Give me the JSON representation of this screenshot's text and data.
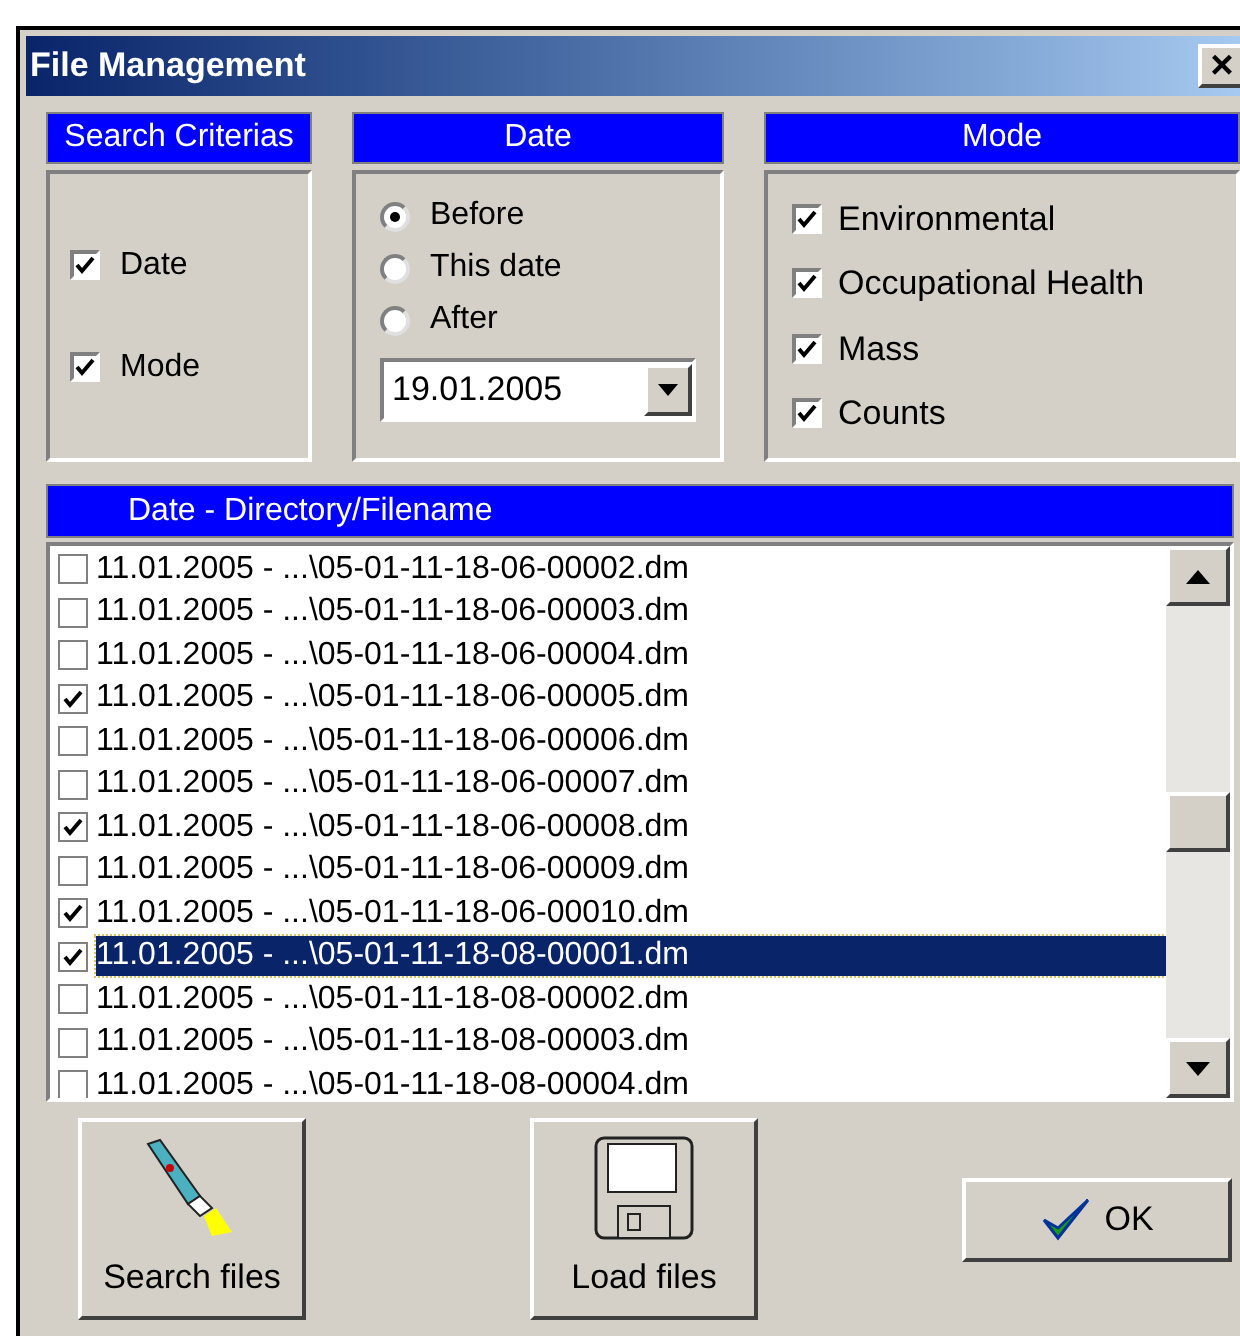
{
  "window": {
    "title": "File Management",
    "close": "×"
  },
  "search_criterias": {
    "title": "Search Criterias",
    "items": [
      {
        "label": "Date",
        "checked": true
      },
      {
        "label": "Mode",
        "checked": true
      }
    ]
  },
  "date": {
    "title": "Date",
    "options": [
      {
        "label": "Before",
        "selected": true
      },
      {
        "label": "This date",
        "selected": false
      },
      {
        "label": "After",
        "selected": false
      }
    ],
    "value": "19.01.2005"
  },
  "mode": {
    "title": "Mode",
    "items": [
      {
        "label": "Environmental",
        "checked": true
      },
      {
        "label": "Occupational Health",
        "checked": true
      },
      {
        "label": "Mass",
        "checked": true
      },
      {
        "label": "Counts",
        "checked": true
      }
    ]
  },
  "file_list": {
    "header": "Date - Directory/Filename",
    "rows": [
      {
        "text": "11.01.2005 - ...\\05-01-11-18-06-00002.dm",
        "checked": false,
        "selected": false
      },
      {
        "text": "11.01.2005 - ...\\05-01-11-18-06-00003.dm",
        "checked": false,
        "selected": false
      },
      {
        "text": "11.01.2005 - ...\\05-01-11-18-06-00004.dm",
        "checked": false,
        "selected": false
      },
      {
        "text": "11.01.2005 - ...\\05-01-11-18-06-00005.dm",
        "checked": true,
        "selected": false
      },
      {
        "text": "11.01.2005 - ...\\05-01-11-18-06-00006.dm",
        "checked": false,
        "selected": false
      },
      {
        "text": "11.01.2005 - ...\\05-01-11-18-06-00007.dm",
        "checked": false,
        "selected": false
      },
      {
        "text": "11.01.2005 - ...\\05-01-11-18-06-00008.dm",
        "checked": true,
        "selected": false
      },
      {
        "text": "11.01.2005 - ...\\05-01-11-18-06-00009.dm",
        "checked": false,
        "selected": false
      },
      {
        "text": "11.01.2005 - ...\\05-01-11-18-06-00010.dm",
        "checked": true,
        "selected": false
      },
      {
        "text": "11.01.2005 - ...\\05-01-11-18-08-00001.dm",
        "checked": true,
        "selected": true
      },
      {
        "text": "11.01.2005 - ...\\05-01-11-18-08-00002.dm",
        "checked": false,
        "selected": false
      },
      {
        "text": "11.01.2005 - ...\\05-01-11-18-08-00003.dm",
        "checked": false,
        "selected": false
      },
      {
        "text": "11.01.2005 - ...\\05-01-11-18-08-00004.dm",
        "checked": false,
        "selected": false
      }
    ]
  },
  "buttons": [
    {
      "kind": "search",
      "label": "Search files"
    },
    {
      "kind": "load",
      "label": "Load files"
    },
    {
      "kind": "ok",
      "label": "OK"
    }
  ]
}
